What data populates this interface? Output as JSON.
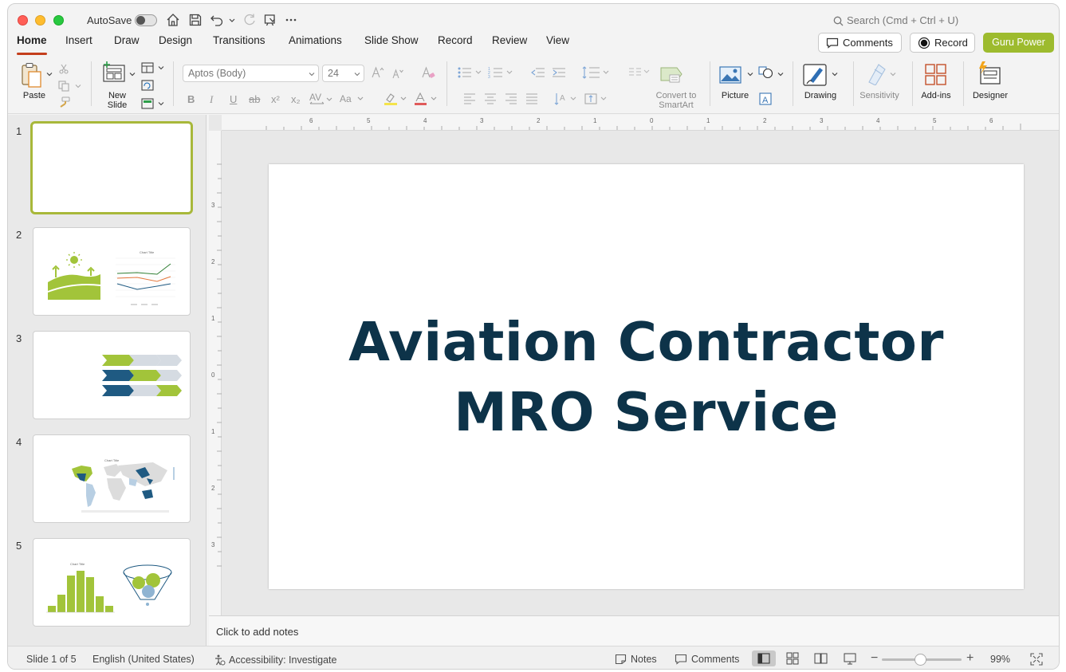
{
  "titlebar": {
    "autosave_label": "AutoSave",
    "search_placeholder": "Search (Cmd + Ctrl + U)"
  },
  "tabs": [
    "Home",
    "Insert",
    "Draw",
    "Design",
    "Transitions",
    "Animations",
    "Slide Show",
    "Record",
    "Review",
    "View"
  ],
  "top_buttons": {
    "comments": "Comments",
    "record": "Record",
    "guru": "Guru Power"
  },
  "ribbon": {
    "paste": "Paste",
    "new_slide_1": "New",
    "new_slide_2": "Slide",
    "font_name": "Aptos (Body)",
    "font_size": "24",
    "convert_1": "Convert to",
    "convert_2": "SmartArt",
    "picture": "Picture",
    "drawing": "Drawing",
    "sensitivity": "Sensitivity",
    "addins": "Add-ins",
    "designer": "Designer"
  },
  "thumbnails": [
    "1",
    "2",
    "3",
    "4",
    "5"
  ],
  "slide": {
    "title_line1": "Aviation Contractor",
    "title_line2": "MRO Service"
  },
  "notes_placeholder": "Click to add notes",
  "status": {
    "slide_of": "Slide 1 of 5",
    "language": "English (United States)",
    "accessibility": "Accessibility: Investigate",
    "notes": "Notes",
    "comments": "Comments",
    "zoom": "99%"
  },
  "colors": {
    "accent_tab": "#c43e1c",
    "guru": "#9dbb2e",
    "title": "#0d3349",
    "green": "#a2c43a",
    "navy": "#1f5a82"
  }
}
